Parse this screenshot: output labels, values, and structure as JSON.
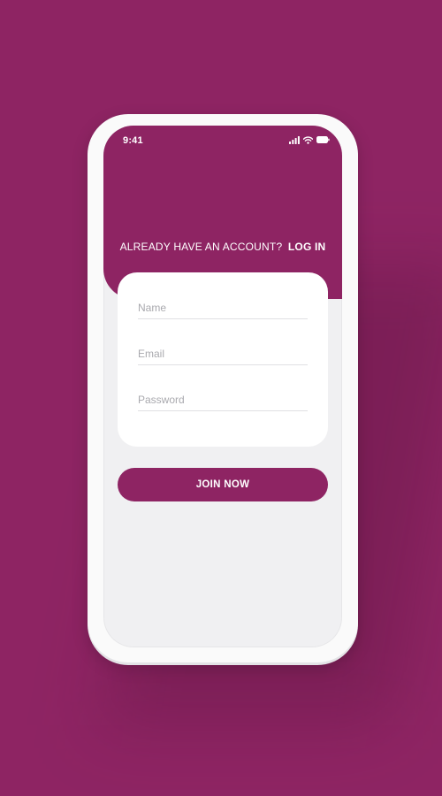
{
  "status_bar": {
    "time": "9:41",
    "icons": [
      "signal-icon",
      "wifi-icon",
      "battery-icon"
    ]
  },
  "header": {
    "prompt_text": "ALREADY HAVE AN ACCOUNT?",
    "login_link": "LOG IN"
  },
  "form": {
    "name_placeholder": "Name",
    "name_value": "",
    "email_placeholder": "Email",
    "email_value": "",
    "password_placeholder": "Password",
    "password_value": ""
  },
  "join_button_label": "JOIN NOW",
  "colors": {
    "brand": "#8e2463",
    "screen_background": "#f0f0f2",
    "card_background": "#ffffff",
    "placeholder": "#a9a9ae"
  }
}
